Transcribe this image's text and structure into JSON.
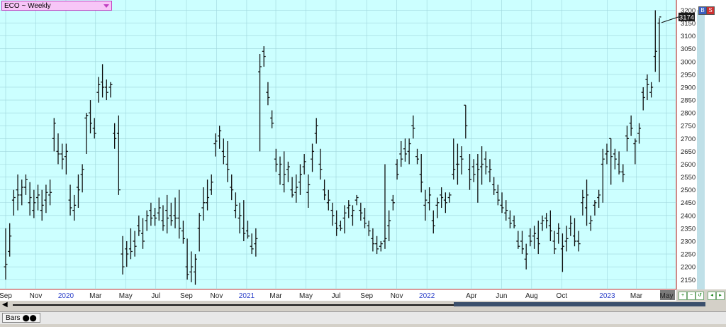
{
  "chart_title": "ECO ~ Weekly",
  "bottom_tab_label": "Bars",
  "last_price_label": "3174",
  "corner_buttons": [
    "B",
    "S"
  ],
  "chart_data": {
    "type": "ohlc",
    "title": "ECO ~ Weekly",
    "interval": "weekly",
    "ylim": [
      2112,
      3240
    ],
    "y_ticks": [
      2150,
      2200,
      2250,
      2300,
      2350,
      2400,
      2450,
      2500,
      2550,
      2600,
      2650,
      2700,
      2750,
      2800,
      2850,
      2900,
      2950,
      3000,
      3050,
      3100,
      3150,
      3200
    ],
    "x_ticks": [
      {
        "label": "Sep",
        "date": "2019-09"
      },
      {
        "label": "Nov",
        "date": "2019-11"
      },
      {
        "label": "2020",
        "date": "2020-01",
        "year": true
      },
      {
        "label": "Mar",
        "date": "2020-03"
      },
      {
        "label": "May",
        "date": "2020-05"
      },
      {
        "label": "Jul",
        "date": "2020-07"
      },
      {
        "label": "Sep",
        "date": "2020-09"
      },
      {
        "label": "Nov",
        "date": "2020-11"
      },
      {
        "label": "2021",
        "date": "2021-01",
        "year": true
      },
      {
        "label": "Mar",
        "date": "2021-03"
      },
      {
        "label": "May",
        "date": "2021-05"
      },
      {
        "label": "Jul",
        "date": "2021-07"
      },
      {
        "label": "Sep",
        "date": "2021-09"
      },
      {
        "label": "Nov",
        "date": "2021-11"
      },
      {
        "label": "2022",
        "date": "2022-01",
        "year": true
      },
      {
        "label": "Apr",
        "date": "2022-04"
      },
      {
        "label": "Jun",
        "date": "2022-06"
      },
      {
        "label": "Aug",
        "date": "2022-08"
      },
      {
        "label": "Oct",
        "date": "2022-10"
      },
      {
        "label": "2023",
        "date": "2023-01",
        "year": true
      },
      {
        "label": "Mar",
        "date": "2023-03"
      },
      {
        "label": "May",
        "date": "2023-05",
        "highlight": true
      }
    ],
    "last_value": 3174,
    "grid": true,
    "bars": [
      [
        2200,
        2150,
        2350,
        2210
      ],
      [
        2260,
        2240,
        2370,
        2320
      ],
      [
        2460,
        2400,
        2500,
        2470
      ],
      [
        2500,
        2420,
        2560,
        2480
      ],
      [
        2480,
        2440,
        2540,
        2510
      ],
      [
        2510,
        2480,
        2560,
        2540
      ],
      [
        2450,
        2400,
        2530,
        2470
      ],
      [
        2420,
        2390,
        2500,
        2450
      ],
      [
        2470,
        2420,
        2520,
        2480
      ],
      [
        2420,
        2380,
        2500,
        2440
      ],
      [
        2460,
        2410,
        2520,
        2490
      ],
      [
        2480,
        2440,
        2540,
        2490
      ],
      [
        2700,
        2650,
        2780,
        2760
      ],
      [
        2650,
        2600,
        2720,
        2640
      ],
      [
        2640,
        2580,
        2680,
        2620
      ],
      [
        2630,
        2560,
        2680,
        2650
      ],
      [
        2460,
        2400,
        2520,
        2430
      ],
      [
        2420,
        2380,
        2480,
        2440
      ],
      [
        2510,
        2430,
        2560,
        2500
      ],
      [
        2560,
        2490,
        2600,
        2580
      ],
      [
        2780,
        2640,
        2800,
        2790
      ],
      [
        2800,
        2720,
        2850,
        2760
      ],
      [
        2740,
        2700,
        2780,
        2720
      ],
      [
        2880,
        2840,
        2940,
        2910
      ],
      [
        2920,
        2860,
        2990,
        2900
      ],
      [
        2900,
        2850,
        2930,
        2880
      ],
      [
        2900,
        2860,
        2920,
        2910
      ],
      [
        2720,
        2660,
        2760,
        2700
      ],
      [
        2720,
        2480,
        2790,
        2500
      ],
      [
        2250,
        2170,
        2320,
        2200
      ],
      [
        2270,
        2200,
        2300,
        2250
      ],
      [
        2270,
        2230,
        2350,
        2260
      ],
      [
        2300,
        2240,
        2340,
        2280
      ],
      [
        2360,
        2320,
        2400,
        2340
      ],
      [
        2330,
        2270,
        2390,
        2300
      ],
      [
        2380,
        2340,
        2420,
        2400
      ],
      [
        2420,
        2360,
        2450,
        2390
      ],
      [
        2400,
        2360,
        2430,
        2390
      ],
      [
        2410,
        2380,
        2470,
        2430
      ],
      [
        2380,
        2340,
        2440,
        2360
      ],
      [
        2420,
        2330,
        2480,
        2390
      ],
      [
        2400,
        2360,
        2450,
        2380
      ],
      [
        2400,
        2350,
        2470,
        2390
      ],
      [
        2390,
        2310,
        2500,
        2350
      ],
      [
        2340,
        2290,
        2380,
        2310
      ],
      [
        2200,
        2150,
        2310,
        2170
      ],
      [
        2180,
        2140,
        2260,
        2200
      ],
      [
        2180,
        2130,
        2250,
        2230
      ],
      [
        2350,
        2260,
        2410,
        2400
      ],
      [
        2430,
        2380,
        2510,
        2450
      ],
      [
        2450,
        2420,
        2540,
        2470
      ],
      [
        2500,
        2480,
        2560,
        2530
      ],
      [
        2680,
        2630,
        2720,
        2690
      ],
      [
        2710,
        2660,
        2750,
        2730
      ],
      [
        2650,
        2600,
        2700,
        2630
      ],
      [
        2600,
        2530,
        2690,
        2580
      ],
      [
        2510,
        2460,
        2560,
        2500
      ],
      [
        2420,
        2390,
        2490,
        2440
      ],
      [
        2390,
        2330,
        2450,
        2400
      ],
      [
        2350,
        2300,
        2460,
        2330
      ],
      [
        2340,
        2310,
        2380,
        2320
      ],
      [
        2280,
        2250,
        2330,
        2270
      ],
      [
        2290,
        2240,
        2350,
        2310
      ],
      [
        2960,
        2650,
        3030,
        2980
      ],
      [
        3040,
        2980,
        3060,
        3020
      ],
      [
        2880,
        2830,
        2920,
        2860
      ],
      [
        2780,
        2740,
        2810,
        2760
      ],
      [
        2620,
        2570,
        2660,
        2600
      ],
      [
        2560,
        2520,
        2630,
        2600
      ],
      [
        2520,
        2490,
        2650,
        2560
      ],
      [
        2580,
        2530,
        2610,
        2590
      ],
      [
        2500,
        2470,
        2550,
        2480
      ],
      [
        2490,
        2450,
        2560,
        2510
      ],
      [
        2530,
        2480,
        2600,
        2560
      ],
      [
        2590,
        2560,
        2640,
        2610
      ],
      [
        2490,
        2430,
        2560,
        2520
      ],
      [
        2620,
        2570,
        2680,
        2650
      ],
      [
        2720,
        2680,
        2780,
        2750
      ],
      [
        2600,
        2540,
        2660,
        2580
      ],
      [
        2500,
        2460,
        2540,
        2480
      ],
      [
        2450,
        2420,
        2500,
        2460
      ],
      [
        2420,
        2360,
        2450,
        2400
      ],
      [
        2370,
        2320,
        2420,
        2350
      ],
      [
        2360,
        2340,
        2380,
        2350
      ],
      [
        2390,
        2330,
        2440,
        2410
      ],
      [
        2430,
        2390,
        2460,
        2440
      ],
      [
        2400,
        2360,
        2440,
        2420
      ],
      [
        2460,
        2440,
        2480,
        2470
      ],
      [
        2420,
        2380,
        2450,
        2410
      ],
      [
        2390,
        2350,
        2430,
        2370
      ],
      [
        2360,
        2320,
        2380,
        2340
      ],
      [
        2310,
        2260,
        2350,
        2290
      ],
      [
        2290,
        2250,
        2320,
        2270
      ],
      [
        2280,
        2260,
        2300,
        2290
      ],
      [
        2300,
        2270,
        2600,
        2310
      ],
      [
        2360,
        2300,
        2420,
        2380
      ],
      [
        2460,
        2420,
        2480,
        2450
      ],
      [
        2600,
        2540,
        2620,
        2560
      ],
      [
        2640,
        2590,
        2690,
        2620
      ],
      [
        2660,
        2610,
        2700,
        2640
      ],
      [
        2650,
        2600,
        2700,
        2680
      ],
      [
        2750,
        2700,
        2790,
        2740
      ],
      [
        2630,
        2600,
        2660,
        2620
      ],
      [
        2560,
        2490,
        2640,
        2530
      ],
      [
        2440,
        2380,
        2500,
        2460
      ],
      [
        2450,
        2420,
        2510,
        2480
      ],
      [
        2380,
        2330,
        2420,
        2360
      ],
      [
        2440,
        2390,
        2470,
        2450
      ],
      [
        2480,
        2430,
        2510,
        2470
      ],
      [
        2460,
        2410,
        2490,
        2450
      ],
      [
        2470,
        2450,
        2490,
        2480
      ],
      [
        2560,
        2540,
        2700,
        2580
      ],
      [
        2600,
        2520,
        2680,
        2600
      ],
      [
        2630,
        2560,
        2670,
        2620
      ],
      [
        2830,
        2700,
        2830,
        2750
      ],
      [
        2580,
        2500,
        2640,
        2540
      ],
      [
        2590,
        2530,
        2620,
        2560
      ],
      [
        2600,
        2450,
        2640,
        2580
      ],
      [
        2590,
        2520,
        2670,
        2600
      ],
      [
        2620,
        2560,
        2650,
        2590
      ],
      [
        2570,
        2530,
        2620,
        2580
      ],
      [
        2520,
        2480,
        2550,
        2500
      ],
      [
        2490,
        2440,
        2520,
        2460
      ],
      [
        2440,
        2410,
        2490,
        2430
      ],
      [
        2410,
        2380,
        2460,
        2420
      ],
      [
        2390,
        2350,
        2420,
        2370
      ],
      [
        2380,
        2350,
        2400,
        2360
      ],
      [
        2300,
        2270,
        2340,
        2280
      ],
      [
        2300,
        2250,
        2340,
        2270
      ],
      [
        2230,
        2190,
        2290,
        2250
      ],
      [
        2320,
        2280,
        2350,
        2300
      ],
      [
        2320,
        2270,
        2360,
        2330
      ],
      [
        2310,
        2250,
        2380,
        2290
      ],
      [
        2370,
        2340,
        2400,
        2380
      ],
      [
        2390,
        2350,
        2410,
        2380
      ],
      [
        2360,
        2300,
        2420,
        2340
      ],
      [
        2300,
        2250,
        2340,
        2270
      ],
      [
        2330,
        2290,
        2370,
        2350
      ],
      [
        2270,
        2180,
        2330,
        2280
      ],
      [
        2300,
        2260,
        2360,
        2310
      ],
      [
        2350,
        2320,
        2400,
        2370
      ],
      [
        2320,
        2280,
        2390,
        2300
      ],
      [
        2300,
        2260,
        2340,
        2290
      ],
      [
        2450,
        2400,
        2500,
        2470
      ],
      [
        2430,
        2360,
        2540,
        2480
      ],
      [
        2370,
        2340,
        2400,
        2380
      ],
      [
        2440,
        2400,
        2460,
        2450
      ],
      [
        2470,
        2430,
        2500,
        2480
      ],
      [
        2600,
        2450,
        2660,
        2620
      ],
      [
        2640,
        2600,
        2680,
        2650
      ],
      [
        2700,
        2520,
        2700,
        2630
      ],
      [
        2640,
        2580,
        2660,
        2620
      ],
      [
        2600,
        2560,
        2650,
        2570
      ],
      [
        2570,
        2530,
        2600,
        2560
      ],
      [
        2710,
        2650,
        2750,
        2700
      ],
      [
        2760,
        2710,
        2790,
        2740
      ],
      [
        2680,
        2600,
        2700,
        2690
      ],
      [
        2720,
        2680,
        2760,
        2740
      ],
      [
        2880,
        2810,
        2900,
        2860
      ],
      [
        2930,
        2850,
        2950,
        2910
      ],
      [
        2880,
        2860,
        2920,
        2900
      ],
      [
        3020,
        2960,
        3200,
        3040
      ],
      [
        3150,
        2920,
        3170,
        3174
      ]
    ]
  }
}
